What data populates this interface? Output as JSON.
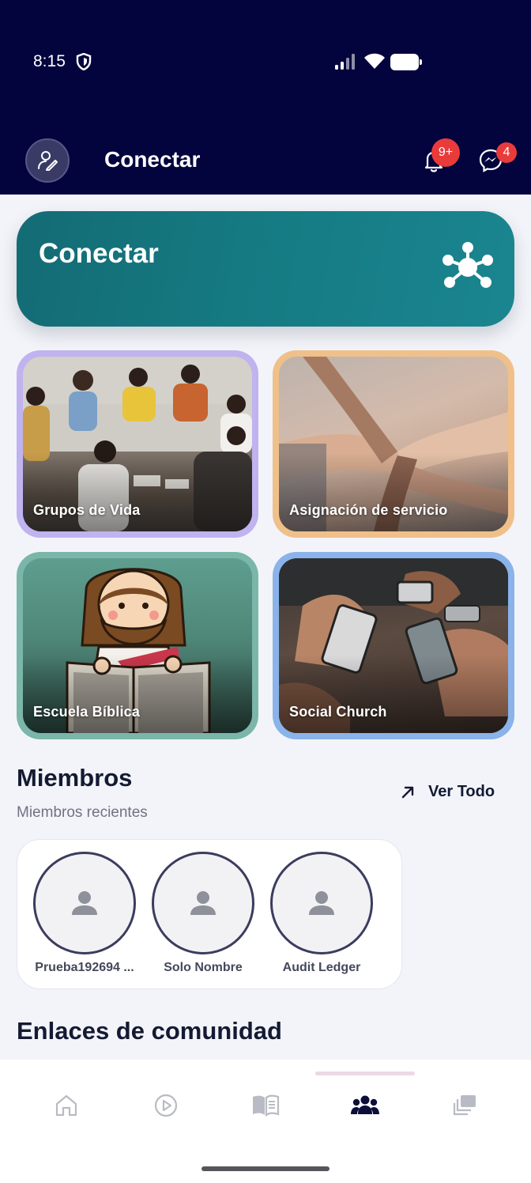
{
  "status_bar": {
    "time": "8:15"
  },
  "header": {
    "title": "Conectar",
    "notifications_badge": "9+",
    "messages_badge": "4"
  },
  "banner": {
    "title": "Conectar"
  },
  "categories": [
    {
      "label": "Grupos de Vida"
    },
    {
      "label": "Asignación de servicio"
    },
    {
      "label": "Escuela Bíblica"
    },
    {
      "label": "Social Church"
    }
  ],
  "members": {
    "title": "Miembros",
    "subtitle": "Miembros recientes",
    "see_all": "Ver Todo",
    "items": [
      {
        "name": "Prueba192694 ..."
      },
      {
        "name": "Solo Nombre"
      },
      {
        "name": "Audit Ledger"
      }
    ]
  },
  "community_links": {
    "title": "Enlaces de comunidad"
  },
  "bottom_nav": {
    "items": [
      {
        "icon": "home-icon",
        "active": false
      },
      {
        "icon": "play-circle-icon",
        "active": false
      },
      {
        "icon": "book-icon",
        "active": false
      },
      {
        "icon": "people-group-icon",
        "active": true
      },
      {
        "icon": "layers-icon",
        "active": false
      }
    ]
  },
  "colors": {
    "header_bg": "#03033d",
    "banner": "#157a82",
    "badge": "#ea3b3b",
    "card_purple": "#c0b3f0",
    "card_orange": "#f0c08a",
    "card_green": "#7ab6a9",
    "card_blue": "#8ab3ea"
  }
}
